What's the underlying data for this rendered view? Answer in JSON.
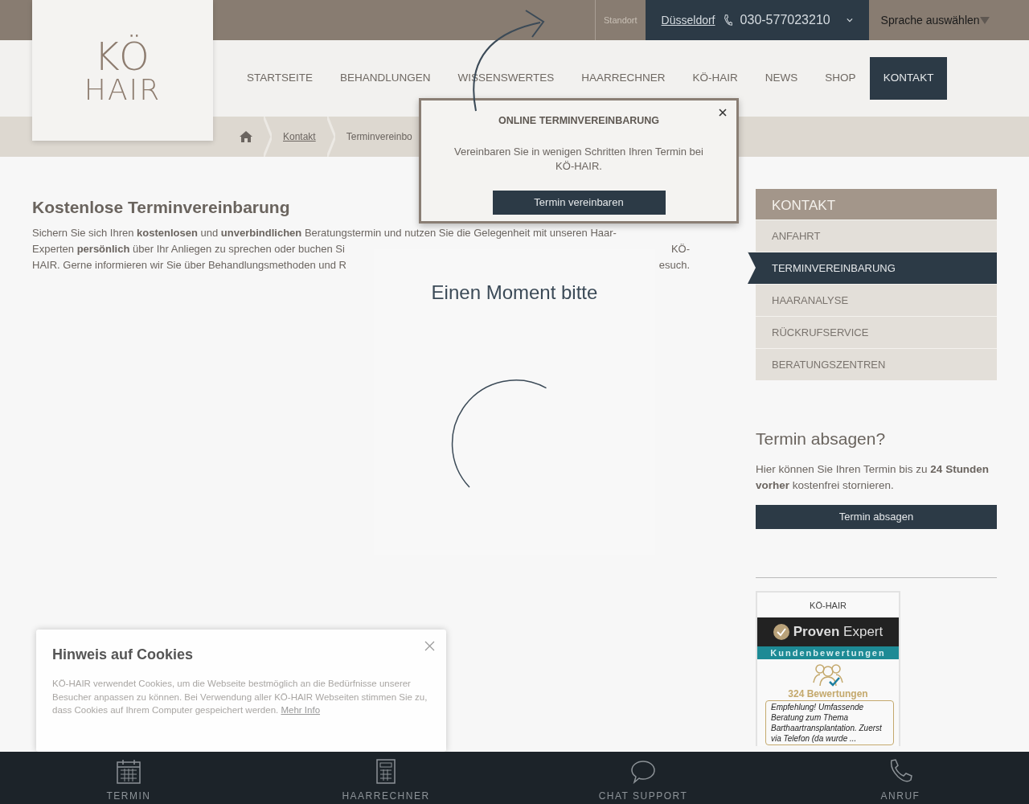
{
  "top_bar": {
    "label": "Standort",
    "city": "Düsseldorf",
    "phone": "030-577023210",
    "language": "Sprache auswählen"
  },
  "logo": {
    "line1": "KÖ",
    "line2": "HAIR"
  },
  "nav": [
    {
      "label": "STARTSEITE",
      "selected": false
    },
    {
      "label": "BEHANDLUNGEN",
      "selected": false
    },
    {
      "label": "WISSENSWERTES",
      "selected": false
    },
    {
      "label": "HAARRECHNER",
      "selected": false
    },
    {
      "label": "KÖ-HAIR",
      "selected": false
    },
    {
      "label": "NEWS",
      "selected": false
    },
    {
      "label": "SHOP",
      "selected": false
    },
    {
      "label": "KONTAKT",
      "selected": true
    }
  ],
  "breadcrumb": [
    "Kontakt",
    "Terminvereinbo"
  ],
  "appointment_popup": {
    "title": "ONLINE TERMINVEREINBARUNG",
    "text": "Vereinbaren Sie in wenigen Schritten Ihren Termin bei KÖ-HAIR.",
    "button": "Termin vereinbaren"
  },
  "main": {
    "heading": "Kostenlose Terminvereinbarung",
    "lines": [
      {
        "left": "Sichern Sie sich Ihren **kostenlosen** und **unverbindlichen** Beratungstermin und nutzen Sie die Gelegenheit mit unseren Haar-"
      },
      {
        "left": "Experten **persönlich** über Ihr Anliegen zu sprechen oder buchen Si",
        "right": "KÖ-"
      },
      {
        "left": "HAIR. Gerne informieren wir Sie über Behandlungsmethoden und R",
        "right": "esuch."
      }
    ]
  },
  "loading_modal": {
    "title": "Einen Moment bitte"
  },
  "sidebar": {
    "title": "KONTAKT",
    "items": [
      {
        "label": "ANFAHRT",
        "selected": false
      },
      {
        "label": "TERMINVEREINBARUNG",
        "selected": true
      },
      {
        "label": "HAARANALYSE",
        "selected": false
      },
      {
        "label": "RÜCKRUFSERVICE",
        "selected": false
      },
      {
        "label": "BERATUNGSZENTREN",
        "selected": false
      }
    ]
  },
  "cancel": {
    "heading": "Termin absagen?",
    "text": "Hier können Sie Ihren Termin bis zu **24 Stunden vorher** kostenfrei stornieren.",
    "button": "Termin absagen"
  },
  "review_widget": {
    "title": "KÖ-HAIR",
    "brand_bold": "Proven",
    "brand": "Expert",
    "subtitle": "Kundenbewertungen",
    "count": "324 Bewertungen",
    "quote": "Empfehlung! Umfassende Beratung zum Thema Barthaartransplantation. Zuerst via Telefon (da wurde ..."
  },
  "cookie": {
    "title": "Hinweis auf Cookies",
    "text": "KÖ-HAIR verwendet Cookies, um die Webseite bestmöglich an die Bedürfnisse unserer Besucher anpassen zu können. Bei Verwendung aller KÖ-HAIR Webseiten stimmen Sie zu, dass Cookies auf Ihrem Computer gespeichert werden.",
    "link": "Mehr Info"
  },
  "bottom_bar": [
    {
      "label": "TERMIN",
      "kind": "calendar"
    },
    {
      "label": "HAARRECHNER",
      "kind": "calculator"
    },
    {
      "label": "CHAT SUPPORT",
      "kind": "chat"
    },
    {
      "label": "ANRUF",
      "kind": "phone"
    }
  ]
}
